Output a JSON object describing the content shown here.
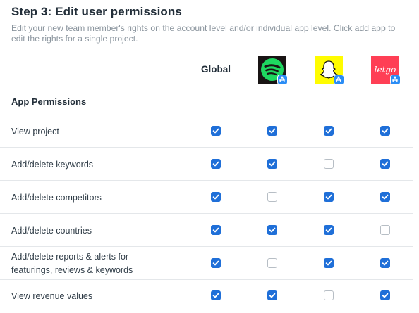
{
  "title": "Step 3: Edit user permissions",
  "subtitle": "Edit your new team member's rights on the account level and/or individual app level. Click add app to edit the rights for a single project.",
  "columns": {
    "global_label": "Global",
    "apps": [
      {
        "name": "Spotify",
        "icon": "spotify-icon",
        "store_badge": "app-store-icon",
        "brand_color": "#1ed760",
        "bg_color": "#191414"
      },
      {
        "name": "Snapchat",
        "icon": "snapchat-icon",
        "store_badge": "app-store-icon",
        "brand_color": "#fffc00",
        "bg_color": "#fffc00"
      },
      {
        "name": "letgo",
        "icon": "letgo-icon",
        "store_badge": "app-store-icon",
        "brand_color": "#ff3f55",
        "bg_color": "#ff3f55",
        "logo_text": "letgo"
      }
    ]
  },
  "section_heading": "App Permissions",
  "permissions": [
    {
      "label": "View project",
      "checks": [
        true,
        true,
        true,
        true
      ]
    },
    {
      "label": "Add/delete keywords",
      "checks": [
        true,
        true,
        false,
        true
      ]
    },
    {
      "label": "Add/delete competitors",
      "checks": [
        true,
        false,
        true,
        true
      ]
    },
    {
      "label": "Add/delete countries",
      "checks": [
        true,
        true,
        true,
        false
      ]
    },
    {
      "label": "Add/delete reports & alerts for featurings, reviews & keywords",
      "checks": [
        true,
        false,
        true,
        true
      ]
    },
    {
      "label": "View revenue values",
      "checks": [
        true,
        true,
        false,
        true
      ]
    }
  ],
  "colors": {
    "checkbox_checked": "#1f6fd8",
    "checkbox_border": "#b7bec5",
    "app_store_badge": "#2b8df5"
  }
}
